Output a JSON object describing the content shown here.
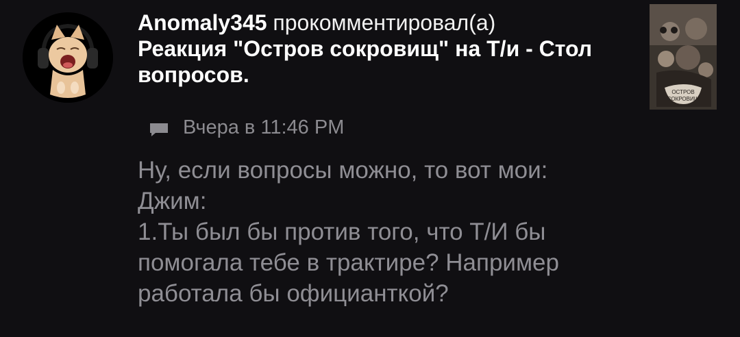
{
  "notification": {
    "username": "Anomaly345",
    "action": "прокомментировал(а)",
    "post_title": "Реакция \"Остров сокровищ\" на Т/и - Стол вопросов.",
    "thumbnail_text": [
      "ОСТРОВ",
      "СОКРОВИЩ"
    ],
    "timestamp": "Вчера в 11:46 PM",
    "comment_lines": [
      "Ну, если вопросы можно, то вот мои:",
      "Джим:",
      "1.Ты был бы против того, что Т/И бы",
      "помогала тебе в трактире? Например",
      "работала бы официанткой?"
    ]
  },
  "icons": {
    "avatar": "cat-with-headphones-avatar",
    "meta": "comment-icon"
  },
  "colors": {
    "background": "#100f12",
    "primary_text": "#ffffff",
    "secondary_text": "#8f8e94"
  }
}
